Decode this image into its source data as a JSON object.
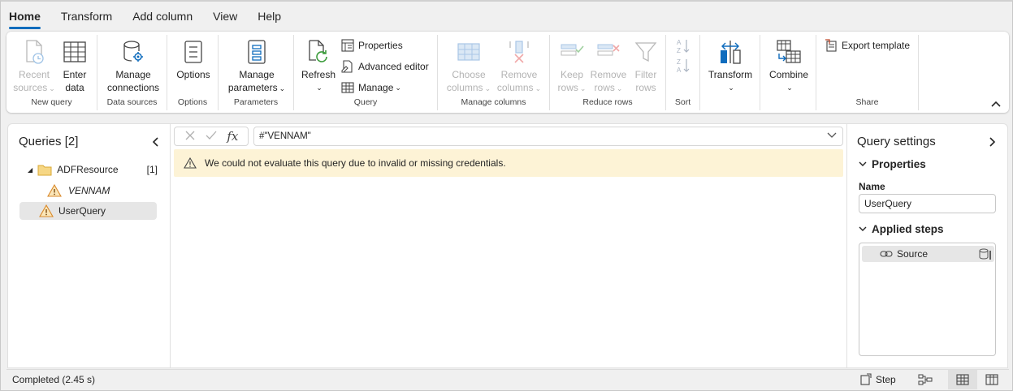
{
  "tabs": [
    "Home",
    "Transform",
    "Add column",
    "View",
    "Help"
  ],
  "ribbon": {
    "new_query": {
      "label": "New query",
      "recent_sources": [
        "Recent",
        "sources"
      ],
      "enter_data": [
        "Enter",
        "data"
      ]
    },
    "data_sources": {
      "label": "Data sources",
      "manage_connections": [
        "Manage",
        "connections"
      ]
    },
    "options": {
      "label": "Options",
      "options_btn": "Options"
    },
    "parameters": {
      "label": "Parameters",
      "manage_parameters": [
        "Manage",
        "parameters"
      ]
    },
    "query": {
      "label": "Query",
      "refresh": "Refresh",
      "properties": "Properties",
      "advanced_editor": "Advanced editor",
      "manage": "Manage"
    },
    "manage_columns": {
      "label": "Manage columns",
      "choose_columns": [
        "Choose",
        "columns"
      ],
      "remove_columns": [
        "Remove",
        "columns"
      ]
    },
    "reduce_rows": {
      "label": "Reduce rows",
      "keep_rows": [
        "Keep",
        "rows"
      ],
      "remove_rows": [
        "Remove",
        "rows"
      ],
      "filter_rows": [
        "Filter",
        "rows"
      ]
    },
    "sort": {
      "label": "Sort"
    },
    "transform": {
      "transform_btn": "Transform"
    },
    "combine": {
      "combine_btn": "Combine"
    },
    "share": {
      "label": "Share",
      "export_template": "Export template"
    }
  },
  "queries_panel": {
    "title": "Queries [2]",
    "folder": {
      "name": "ADFResource",
      "count": "[1]"
    },
    "items": [
      "VENNAM",
      "UserQuery"
    ]
  },
  "formula_bar": {
    "value": "#\"VENNAM\""
  },
  "warning": {
    "message": "We could not evaluate this query due to invalid or missing credentials."
  },
  "query_settings": {
    "title": "Query settings",
    "properties_header": "Properties",
    "name_label": "Name",
    "name_value": "UserQuery",
    "applied_steps_header": "Applied steps",
    "steps": [
      "Source"
    ]
  },
  "status_bar": {
    "text": "Completed (2.45 s)",
    "step_label": "Step"
  },
  "colors": {
    "accent": "#0f6cbd",
    "warning_bg": "#fdf3d6",
    "warning_icon": "#e8a33d",
    "folder": "#f2c45b"
  }
}
